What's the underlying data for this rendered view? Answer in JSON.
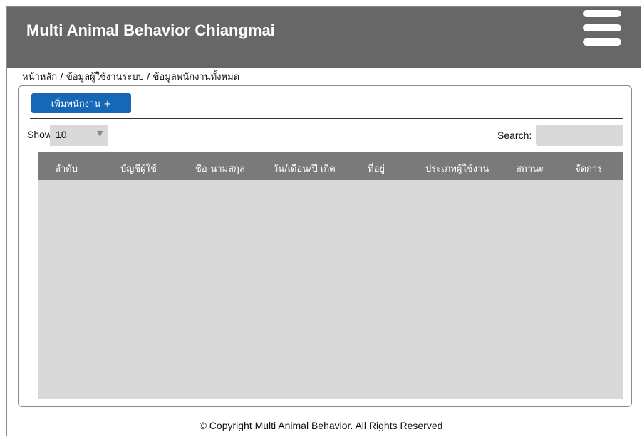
{
  "header": {
    "title": "Multi Animal Behavior Chiangmai",
    "menu_icon": "hamburger-menu-icon"
  },
  "breadcrumb": {
    "items": [
      "หน้าหลัก",
      "ข้อมูลผู้ใช้งานระบบ",
      "ข้อมูลพนักงานทั้งหมด"
    ],
    "separator": " / "
  },
  "toolbar": {
    "add_label": "เพิ่มพนักงาน +",
    "show_label": "Show",
    "page_size": "10",
    "search_label": "Search:",
    "search_value": ""
  },
  "table": {
    "columns": [
      "ลำดับ",
      "บัญชีผู้ใช้",
      "ชื่อ-นามสกุล",
      "วัน/เดือน/ปี เกิด",
      "ที่อยู่",
      "ประเภทผู้ใช้งาน",
      "สถานะ",
      "จัดการ"
    ],
    "rows": []
  },
  "footer": {
    "copyright": "© Copyright Multi Animal Behavior. All Rights Reserved"
  },
  "colors": {
    "header_bg": "#676767",
    "primary_button": "#1668b6",
    "table_header_bg": "#7a7a7a",
    "table_body_bg": "#d8d8d8",
    "input_bg": "#d9d9d9"
  }
}
